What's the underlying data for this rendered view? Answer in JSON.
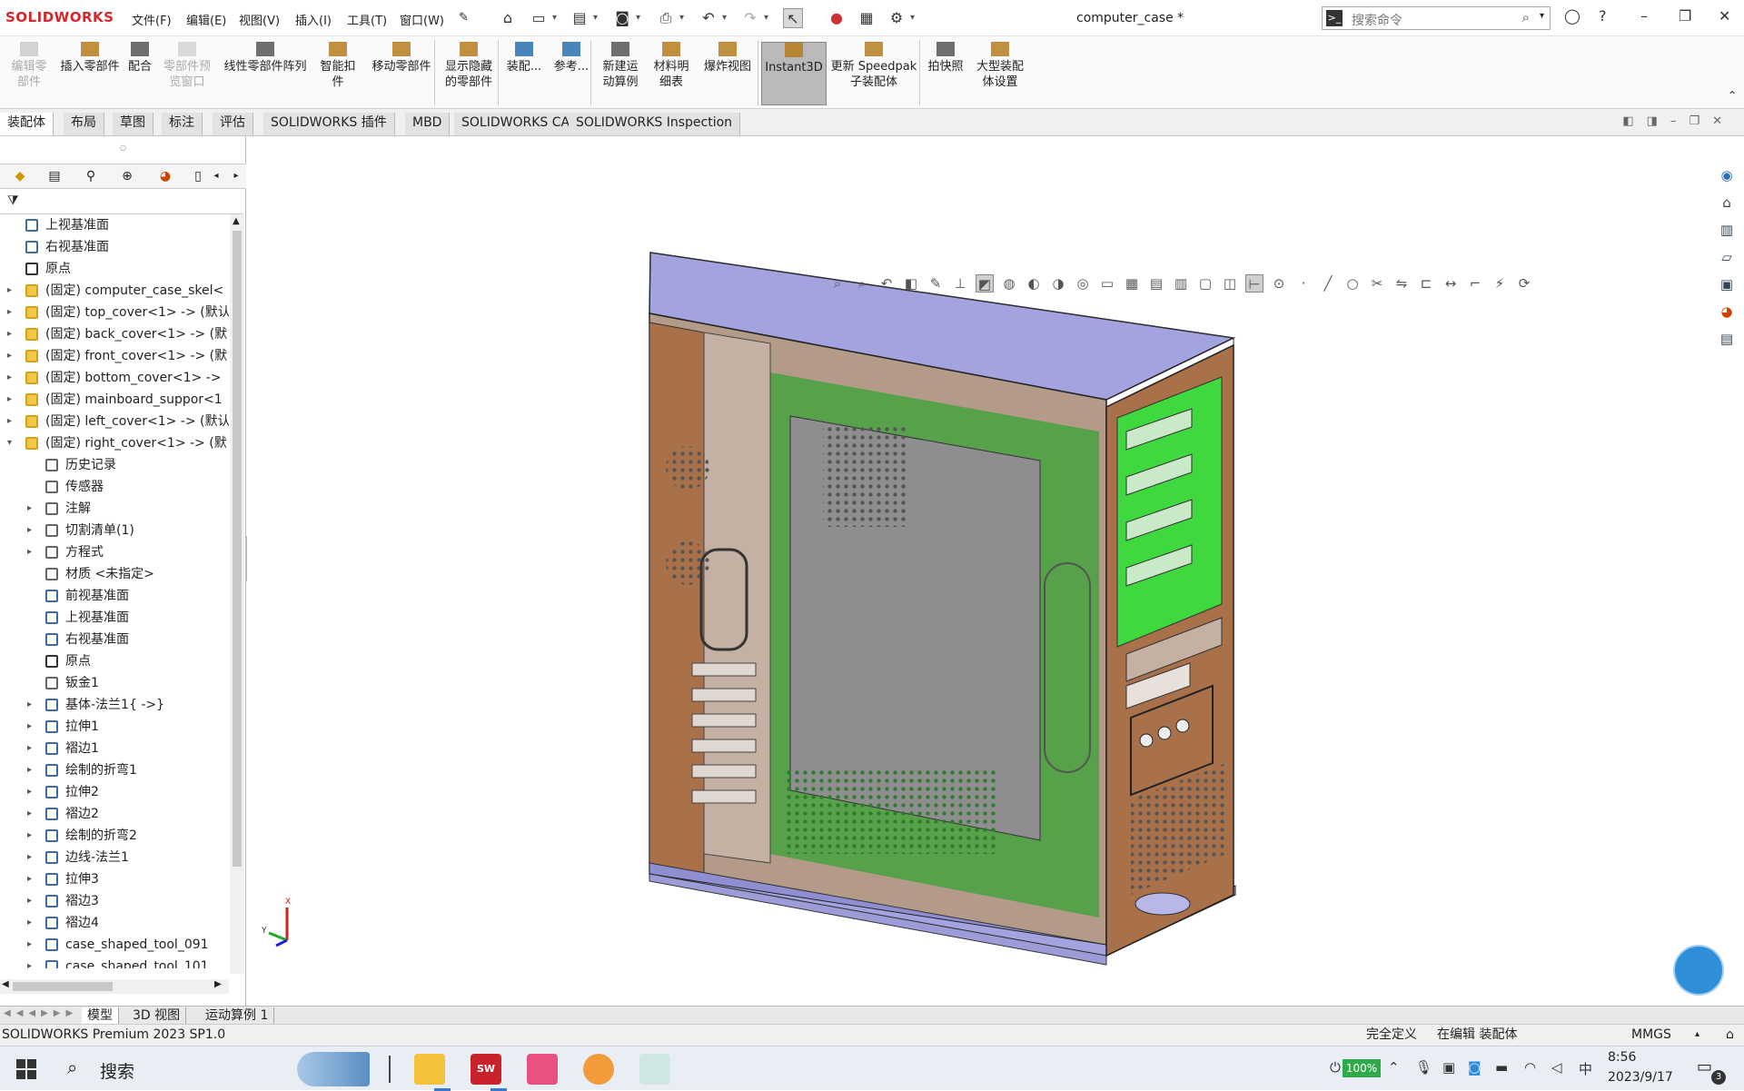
{
  "app": {
    "logo": "SOLIDWORKS",
    "doc_title": "computer_case *"
  },
  "menu": [
    "文件(F)",
    "编辑(E)",
    "视图(V)",
    "插入(I)",
    "工具(T)",
    "窗口(W)"
  ],
  "search": {
    "placeholder": "搜索命令"
  },
  "ribbon": [
    {
      "l1": "编辑零",
      "l2": "部件",
      "disabled": true,
      "icon": "edit-component-icon"
    },
    {
      "l1": "插入零部件",
      "l2": "",
      "disabled": false,
      "icon": "insert-component-icon"
    },
    {
      "l1": "配合",
      "l2": "",
      "disabled": false,
      "icon": "mate-icon"
    },
    {
      "l1": "零部件预",
      "l2": "览窗口",
      "disabled": true,
      "icon": "component-preview-icon"
    },
    {
      "l1": "线性零部件阵列",
      "l2": "",
      "disabled": false,
      "icon": "linear-pattern-icon"
    },
    {
      "l1": "智能扣",
      "l2": "件",
      "disabled": false,
      "icon": "smart-fasteners-icon"
    },
    {
      "l1": "移动零部件",
      "l2": "",
      "disabled": false,
      "icon": "move-component-icon"
    },
    {
      "l1": "显示隐藏",
      "l2": "的零部件",
      "disabled": false,
      "icon": "show-hidden-icon"
    },
    {
      "l1": "装配...",
      "l2": "",
      "disabled": false,
      "icon": "assembly-features-icon"
    },
    {
      "l1": "参考...",
      "l2": "",
      "disabled": false,
      "icon": "reference-geometry-icon"
    },
    {
      "l1": "新建运",
      "l2": "动算例",
      "disabled": false,
      "icon": "new-motion-study-icon"
    },
    {
      "l1": "材料明",
      "l2": "细表",
      "disabled": false,
      "icon": "bom-icon"
    },
    {
      "l1": "爆炸视图",
      "l2": "",
      "disabled": false,
      "icon": "exploded-view-icon"
    },
    {
      "l1": "Instant3D",
      "l2": "",
      "disabled": false,
      "active": true,
      "icon": "instant3d-icon"
    },
    {
      "l1": "更新 Speedpak",
      "l2": "子装配体",
      "disabled": false,
      "icon": "speedpak-icon"
    },
    {
      "l1": "拍快照",
      "l2": "",
      "disabled": false,
      "icon": "snapshot-icon"
    },
    {
      "l1": "大型装配",
      "l2": "体设置",
      "disabled": false,
      "icon": "large-assembly-icon"
    }
  ],
  "tabs": [
    "装配体",
    "布局",
    "草图",
    "标注",
    "评估",
    "SOLIDWORKS 插件",
    "MBD",
    "SOLIDWORKS CAM",
    "SOLIDWORKS Inspection"
  ],
  "tree": [
    {
      "indent": 0,
      "label": "上视基准面",
      "icon": "plane",
      "caret": ""
    },
    {
      "indent": 0,
      "label": "右视基准面",
      "icon": "plane",
      "caret": ""
    },
    {
      "indent": 0,
      "label": "原点",
      "icon": "origin",
      "caret": ""
    },
    {
      "indent": 0,
      "label": "(固定) computer_case_skel<",
      "icon": "part",
      "caret": "▸"
    },
    {
      "indent": 0,
      "label": "(固定) top_cover<1> -> (默认",
      "icon": "part",
      "caret": "▸"
    },
    {
      "indent": 0,
      "label": "(固定) back_cover<1> -> (默",
      "icon": "part",
      "caret": "▸"
    },
    {
      "indent": 0,
      "label": "(固定) front_cover<1> -> (默",
      "icon": "part",
      "caret": "▸"
    },
    {
      "indent": 0,
      "label": "(固定) bottom_cover<1> ->",
      "icon": "part",
      "caret": "▸"
    },
    {
      "indent": 0,
      "label": "(固定) mainboard_suppor<1",
      "icon": "part",
      "caret": "▸"
    },
    {
      "indent": 0,
      "label": "(固定) left_cover<1> -> (默认",
      "icon": "part",
      "caret": "▸"
    },
    {
      "indent": 0,
      "label": "(固定) right_cover<1> -> (默",
      "icon": "part",
      "caret": "▾"
    },
    {
      "indent": 1,
      "label": "历史记录",
      "icon": "history",
      "caret": ""
    },
    {
      "indent": 1,
      "label": "传感器",
      "icon": "sensor",
      "caret": ""
    },
    {
      "indent": 1,
      "label": "注解",
      "icon": "annotation",
      "caret": "▸"
    },
    {
      "indent": 1,
      "label": "切割清单(1)",
      "icon": "cutlist",
      "caret": "▸"
    },
    {
      "indent": 1,
      "label": "方程式",
      "icon": "equation",
      "caret": "▸"
    },
    {
      "indent": 1,
      "label": "材质 <未指定>",
      "icon": "material",
      "caret": ""
    },
    {
      "indent": 1,
      "label": "前视基准面",
      "icon": "plane",
      "caret": ""
    },
    {
      "indent": 1,
      "label": "上视基准面",
      "icon": "plane",
      "caret": ""
    },
    {
      "indent": 1,
      "label": "右视基准面",
      "icon": "plane",
      "caret": ""
    },
    {
      "indent": 1,
      "label": "原点",
      "icon": "origin",
      "caret": ""
    },
    {
      "indent": 1,
      "label": "钣金1",
      "icon": "sheetmetal",
      "caret": ""
    },
    {
      "indent": 1,
      "label": "基体-法兰1{ ->}",
      "icon": "flange",
      "caret": "▸"
    },
    {
      "indent": 1,
      "label": "拉伸1",
      "icon": "extrude",
      "caret": "▸"
    },
    {
      "indent": 1,
      "label": "褶边1",
      "icon": "hem",
      "caret": "▸"
    },
    {
      "indent": 1,
      "label": "绘制的折弯1",
      "icon": "bend",
      "caret": "▸"
    },
    {
      "indent": 1,
      "label": "拉伸2",
      "icon": "extrude",
      "caret": "▸"
    },
    {
      "indent": 1,
      "label": "褶边2",
      "icon": "hem",
      "caret": "▸"
    },
    {
      "indent": 1,
      "label": "绘制的折弯2",
      "icon": "bend",
      "caret": "▸"
    },
    {
      "indent": 1,
      "label": "边线-法兰1",
      "icon": "edgeflange",
      "caret": "▸"
    },
    {
      "indent": 1,
      "label": "拉伸3",
      "icon": "extrude",
      "caret": "▸"
    },
    {
      "indent": 1,
      "label": "褶边3",
      "icon": "hem",
      "caret": "▸"
    },
    {
      "indent": 1,
      "label": "褶边4",
      "icon": "hem",
      "caret": "▸"
    },
    {
      "indent": 1,
      "label": "case_shaped_tool_091",
      "icon": "tool",
      "caret": "▸"
    },
    {
      "indent": 1,
      "label": "case_shaped_tool_101",
      "icon": "tool",
      "caret": "▸"
    }
  ],
  "bottom_tabs": [
    "模型",
    "3D 视图",
    "运动算例 1"
  ],
  "status": {
    "version": "SOLIDWORKS Premium 2023 SP1.0",
    "defined": "完全定义",
    "editing": "在编辑 装配体",
    "units": "MMGS"
  },
  "taskbar": {
    "search": "搜索",
    "battery": "100%",
    "ime": "中",
    "time": "8:56",
    "date": "2023/9/17",
    "notif": "3"
  },
  "axis": {
    "x": "X",
    "y": "Y"
  },
  "colors": {
    "accent": "#d7262b",
    "ribbon_active": "#b9b9b9",
    "case_blue": "#a3a3e0",
    "case_brown": "#a8714a",
    "board_green": "#3fbf3f"
  }
}
